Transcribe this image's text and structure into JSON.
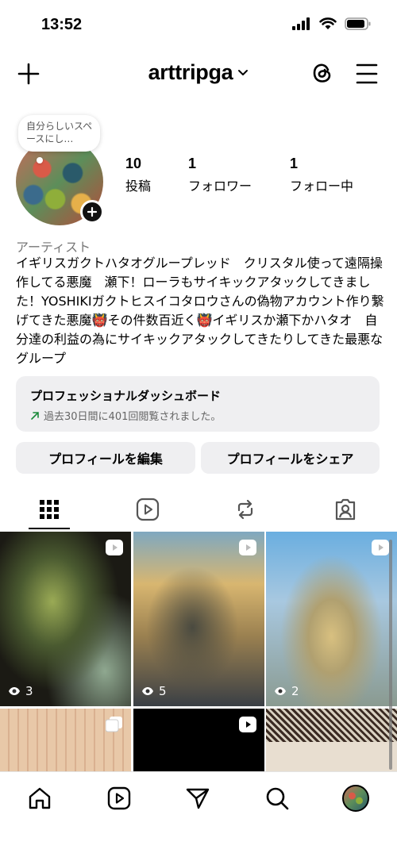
{
  "status": {
    "time": "13:52"
  },
  "header": {
    "username": "arttripga"
  },
  "note": {
    "text": "自分らしいスペースにし…"
  },
  "stats": [
    {
      "value": "10",
      "label": "投稿"
    },
    {
      "value": "1",
      "label": "フォロワー"
    },
    {
      "value": "1",
      "label": "フォロー中"
    }
  ],
  "profile": {
    "category": "アーティスト",
    "bio": "イギリスガクトハタオグループレッド　クリスタル使って遠隔操作してる悪魔　瀬下！ローラもサイキックアタックしてきました！YOSHIKIガクトヒスイコタロウさんの偽物アカウント作り繋げてきた悪魔👹その件数百近く👹イギリスか瀬下かハタオ　自分達の利益の為にサイキックアタックしてきたりしてきた最悪なグループ"
  },
  "dashboard": {
    "title": "プロフェッショナルダッシュボード",
    "subtitle": "過去30日間に401回閲覧されました。"
  },
  "buttons": {
    "edit": "プロフィールを編集",
    "share": "プロフィールをシェア"
  },
  "grid": [
    {
      "views": "3",
      "type": "reel"
    },
    {
      "views": "5",
      "type": "reel"
    },
    {
      "views": "2",
      "type": "reel"
    },
    {
      "views": "",
      "type": "carousel"
    },
    {
      "views": "",
      "type": "reel"
    },
    {
      "views": "",
      "type": "post"
    }
  ]
}
